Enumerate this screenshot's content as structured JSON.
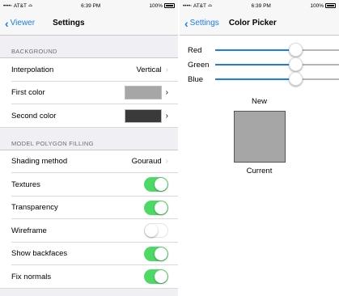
{
  "left": {
    "status": {
      "carrier": "••••◦ AT&T",
      "wifi": "⌓",
      "time": "6:39 PM",
      "battery": "100%"
    },
    "nav": {
      "back_label": "Viewer",
      "title": "Settings"
    },
    "background_section": {
      "header": "BACKGROUND",
      "interpolation": {
        "label": "Interpolation",
        "value": "Vertical"
      },
      "first_color": {
        "label": "First color",
        "color": "#a6a6a6"
      },
      "second_color": {
        "label": "Second color",
        "color": "#3a3a3a"
      }
    },
    "model_section": {
      "header": "MODEL POLYGON FILLING",
      "shading": {
        "label": "Shading method",
        "value": "Gouraud"
      },
      "toggles": [
        {
          "label": "Textures",
          "on": true
        },
        {
          "label": "Transparency",
          "on": true
        },
        {
          "label": "Wireframe",
          "on": false
        },
        {
          "label": "Show backfaces",
          "on": true
        },
        {
          "label": "Fix normals",
          "on": true
        }
      ]
    }
  },
  "right": {
    "status": {
      "carrier": "••••◦ AT&T",
      "wifi": "⌓",
      "time": "6:39 PM",
      "battery": "100%"
    },
    "nav": {
      "back_label": "Settings",
      "title": "Color Picker"
    },
    "sliders": [
      {
        "label": "Red",
        "value": 0.65
      },
      {
        "label": "Green",
        "value": 0.65
      },
      {
        "label": "Blue",
        "value": 0.65
      }
    ],
    "new_label": "New",
    "current_label": "Current",
    "swatch_color": "#a6a6a6"
  },
  "colors": {
    "accent": "#1a7cf5",
    "switch_on": "#4cd964"
  }
}
